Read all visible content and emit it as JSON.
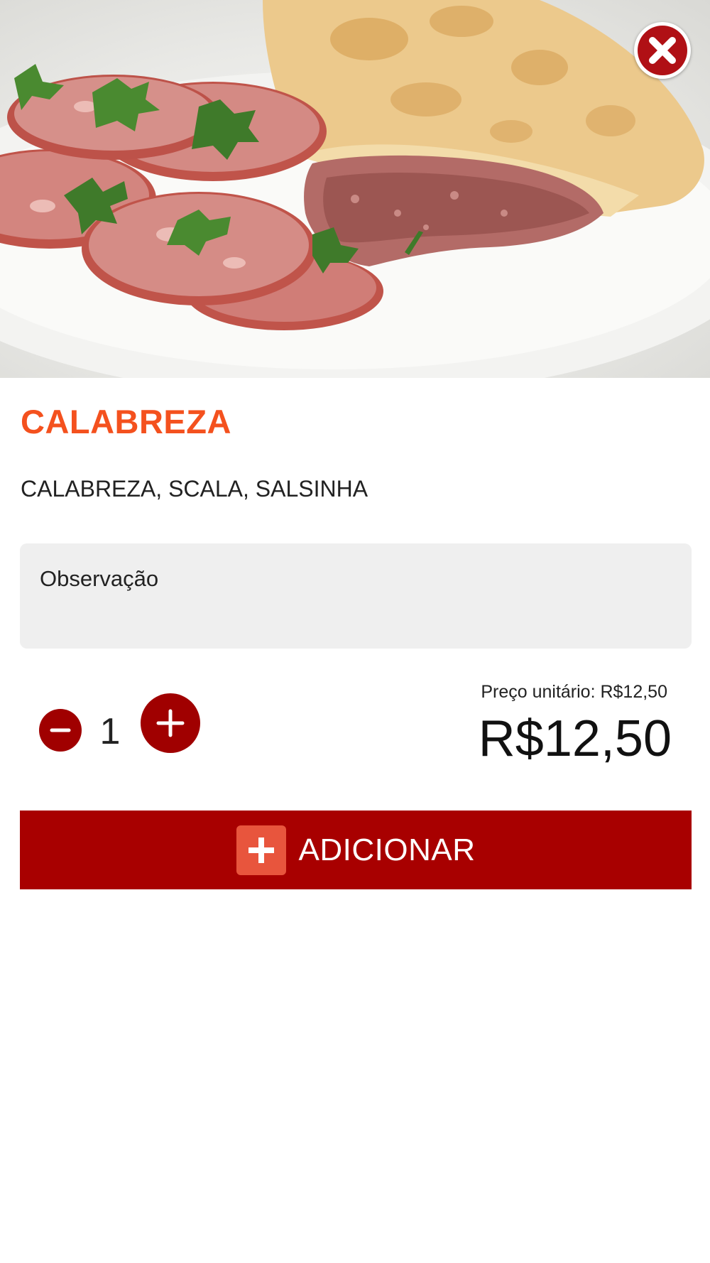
{
  "product": {
    "photo_icon": "product-photo-pastel-calabresa",
    "name": "CALABREZA",
    "description": "CALABREZA, SCALA, SALSINHA"
  },
  "close": {
    "icon": "close-x-circle-icon"
  },
  "observation": {
    "placeholder": "Observação",
    "value": ""
  },
  "quantity": {
    "value": "1",
    "minus_icon": "minus-circle-icon",
    "plus_icon": "plus-circle-icon"
  },
  "price": {
    "unit_label": "Preço unitário: R$12,50",
    "total": "R$12,50"
  },
  "add_button": {
    "label": "ADICIONAR",
    "icon": "plus-square-icon"
  },
  "colors": {
    "title": "#f4511e",
    "accent": "#a80000",
    "button_icon_bg": "#e8553d",
    "field_bg": "#efefef"
  }
}
